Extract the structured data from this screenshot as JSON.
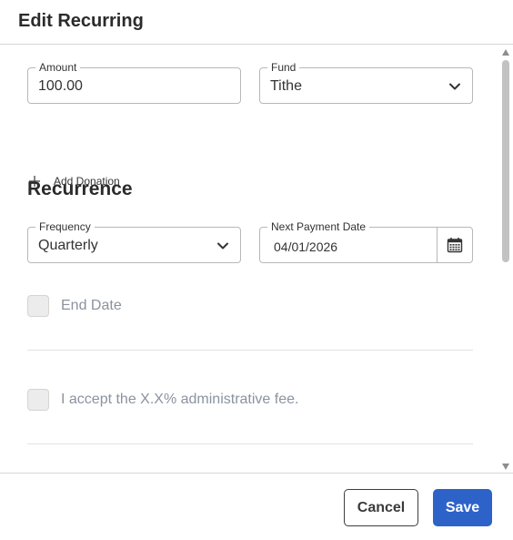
{
  "header": {
    "title": "Edit Recurring"
  },
  "donation": {
    "amount_label": "Amount",
    "amount_value": "100.00",
    "fund_label": "Fund",
    "fund_value": "Tithe",
    "add_donation_label": "Add Donation"
  },
  "recurrence": {
    "heading": "Recurrence",
    "frequency_label": "Frequency",
    "frequency_value": "Quarterly",
    "next_payment_label": "Next Payment Date",
    "next_payment_value": "04/01/2026",
    "end_date_label": "End Date",
    "end_date_checked": false,
    "fee_label": "I accept the X.X% administrative fee.",
    "fee_checked": false
  },
  "footer": {
    "cancel_label": "Cancel",
    "save_label": "Save"
  },
  "colors": {
    "primary": "#2d63c8",
    "muted_text": "#8a939e",
    "border": "#b8b8b8"
  }
}
